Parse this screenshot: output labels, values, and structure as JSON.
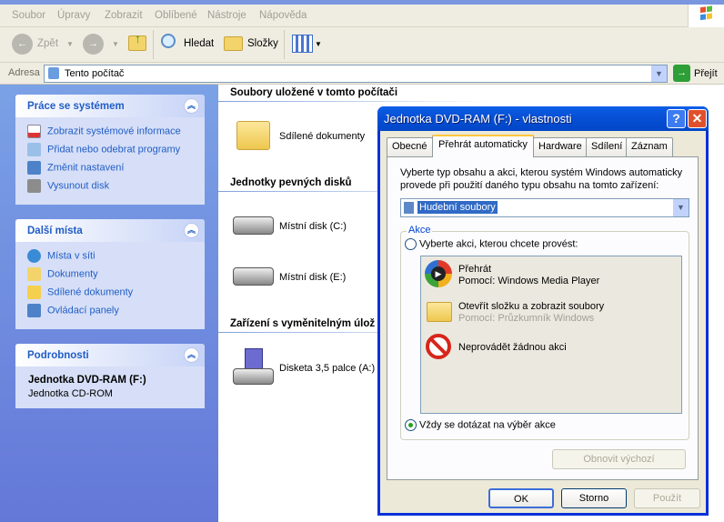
{
  "menu": [
    "Soubor",
    "Úpravy",
    "Zobrazit",
    "Oblíbené",
    "Nástroje",
    "Nápověda"
  ],
  "toolbar": {
    "back": "Zpět",
    "search": "Hledat",
    "folders": "Složky"
  },
  "address": {
    "label": "Adresa",
    "value": "Tento počítač",
    "go": "Přejít"
  },
  "left": {
    "panels": [
      {
        "title": "Práce se systémem",
        "items": [
          "Zobrazit systémové informace",
          "Přidat nebo odebrat programy",
          "Změnit nastavení",
          "Vysunout disk"
        ]
      },
      {
        "title": "Další místa",
        "items": [
          "Místa v síti",
          "Dokumenty",
          "Sdílené dokumenty",
          "Ovládací panely"
        ]
      },
      {
        "title": "Podrobnosti",
        "name": "Jednotka DVD-RAM (F:)",
        "type": "Jednotka CD-ROM"
      }
    ]
  },
  "main": {
    "sections": [
      {
        "title": "Soubory uložené v tomto počítači",
        "items": [
          "Sdílené dokumenty"
        ]
      },
      {
        "title": "Jednotky pevných disků",
        "items": [
          "Místní disk (C:)",
          "Místní disk (E:)"
        ]
      },
      {
        "title": "Zařízení s vyměnitelným úlož",
        "items": [
          "Disketa 3,5 palce (A:)"
        ]
      }
    ]
  },
  "dialog": {
    "title": "Jednotka DVD-RAM (F:) - vlastnosti",
    "tabs": [
      "Obecné",
      "Přehrát automaticky",
      "Hardware",
      "Sdílení",
      "Záznam"
    ],
    "intro1": "Vyberte typ obsahu a akci, kterou systém Windows automaticky",
    "intro2": "provede při použití daného typu obsahu na tomto zařízení:",
    "content_type": "Hudební soubory",
    "group": "Akce",
    "radio_choose": "Vyberte akci, kterou chcete provést:",
    "actions": [
      {
        "title": "Přehrát",
        "sub": "Pomocí: Windows Media Player"
      },
      {
        "title": "Otevřít složku a zobrazit soubory",
        "sub": "Pomocí: Průzkumník Windows"
      },
      {
        "title": "Neprovádět žádnou akci"
      }
    ],
    "radio_ask": "Vždy se dotázat na výběr akce",
    "restore": "Obnovit výchozí",
    "ok": "OK",
    "cancel": "Storno",
    "apply": "Použít"
  }
}
